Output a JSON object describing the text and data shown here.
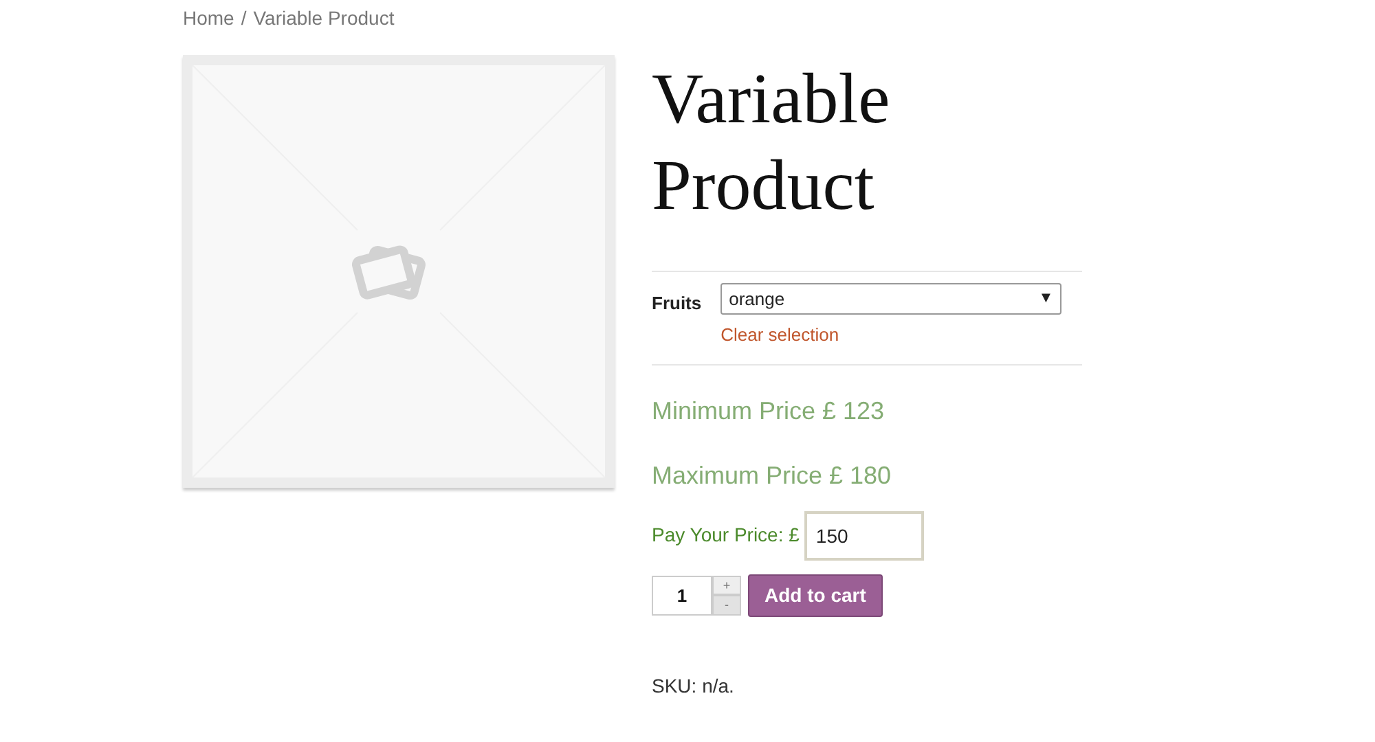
{
  "breadcrumb": {
    "link": "Home",
    "separator": "/",
    "current": "Variable Product"
  },
  "product": {
    "title": "Variable Product",
    "attribute": {
      "label": "Fruits",
      "value": "orange",
      "arrow": "▼",
      "clear_link": "Clear selection"
    },
    "min_price": "Minimum Price £ 123",
    "max_price": "Maximum Price £ 180",
    "pay_price": {
      "label": "Pay Your Price: £",
      "value": "150"
    },
    "quantity": {
      "value": "1",
      "plus": "+",
      "minus": "-"
    },
    "add_to_cart": "Add to cart",
    "sku": "SKU: n/a."
  }
}
